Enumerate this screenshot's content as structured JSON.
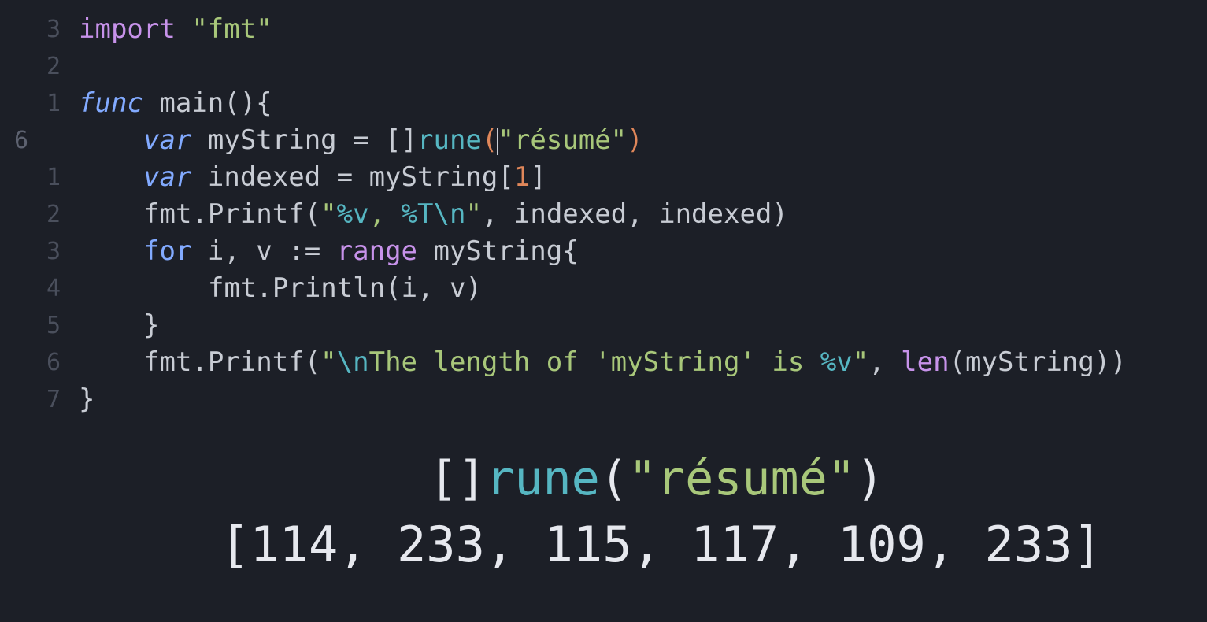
{
  "colors": {
    "background": "#1c1f27",
    "plain": "#c8ccd4",
    "keyword": "#c792ea",
    "italic_keyword": "#82aaff",
    "string": "#a8c77a",
    "escape": "#56b6c2",
    "type": "#56b6c2",
    "number": "#e0875a",
    "line_number": "#4a4f5c",
    "preview_text": "#e6e8ee"
  },
  "editor": {
    "lines": [
      {
        "num": "3",
        "current": false,
        "indent": 0,
        "tokens": [
          {
            "t": "import",
            "c": "keyword"
          },
          {
            "t": " "
          },
          {
            "t": "\"fmt\"",
            "c": "string"
          }
        ]
      },
      {
        "num": "2",
        "current": false,
        "indent": 0,
        "tokens": []
      },
      {
        "num": "1",
        "current": false,
        "indent": 0,
        "tokens": [
          {
            "t": "func",
            "c": "italic_keyword",
            "i": true
          },
          {
            "t": " main(){"
          }
        ]
      },
      {
        "num": "6",
        "current": true,
        "indent": 1,
        "tokens": [
          {
            "t": "var",
            "c": "italic_keyword",
            "i": true
          },
          {
            "t": " myString = []"
          },
          {
            "t": "rune",
            "c": "type"
          },
          {
            "t": "(",
            "c": "number"
          },
          {
            "cursor": true
          },
          {
            "t": "\"résumé\"",
            "c": "string"
          },
          {
            "t": ")",
            "c": "number"
          }
        ]
      },
      {
        "num": "1",
        "current": false,
        "indent": 1,
        "tokens": [
          {
            "t": "var",
            "c": "italic_keyword",
            "i": true
          },
          {
            "t": " indexed = myString["
          },
          {
            "t": "1",
            "c": "number"
          },
          {
            "t": "]"
          }
        ]
      },
      {
        "num": "2",
        "current": false,
        "indent": 1,
        "tokens": [
          {
            "t": "fmt.Printf("
          },
          {
            "t": "\"",
            "c": "string"
          },
          {
            "t": "%v",
            "c": "escape"
          },
          {
            "t": ", ",
            "c": "string"
          },
          {
            "t": "%T\\n",
            "c": "escape"
          },
          {
            "t": "\"",
            "c": "string"
          },
          {
            "t": ", indexed, indexed)"
          }
        ]
      },
      {
        "num": "3",
        "current": false,
        "indent": 1,
        "tokens": [
          {
            "t": "for",
            "c": "italic_keyword"
          },
          {
            "t": " i, v := "
          },
          {
            "t": "range",
            "c": "keyword"
          },
          {
            "t": " myString{"
          }
        ]
      },
      {
        "num": "4",
        "current": false,
        "indent": 2,
        "tokens": [
          {
            "t": "fmt.Println(i, v)"
          }
        ]
      },
      {
        "num": "5",
        "current": false,
        "indent": 1,
        "tokens": [
          {
            "t": "}"
          }
        ]
      },
      {
        "num": "6",
        "current": false,
        "indent": 1,
        "tokens": [
          {
            "t": "fmt.Printf("
          },
          {
            "t": "\"",
            "c": "string"
          },
          {
            "t": "\\n",
            "c": "escape"
          },
          {
            "t": "The length of 'myString' is ",
            "c": "string"
          },
          {
            "t": "%v",
            "c": "escape"
          },
          {
            "t": "\"",
            "c": "string"
          },
          {
            "t": ", "
          },
          {
            "t": "len",
            "c": "keyword"
          },
          {
            "t": "(myString))"
          }
        ]
      },
      {
        "num": "7",
        "current": false,
        "indent": 0,
        "tokens": [
          {
            "t": "}"
          }
        ]
      }
    ]
  },
  "preview": {
    "expression_tokens": [
      {
        "t": "[]"
      },
      {
        "t": "rune",
        "c": "type"
      },
      {
        "t": "("
      },
      {
        "t": "\"résumé\"",
        "c": "string"
      },
      {
        "t": ")"
      }
    ],
    "result": "[114, 233, 115, 117, 109, 233]"
  }
}
